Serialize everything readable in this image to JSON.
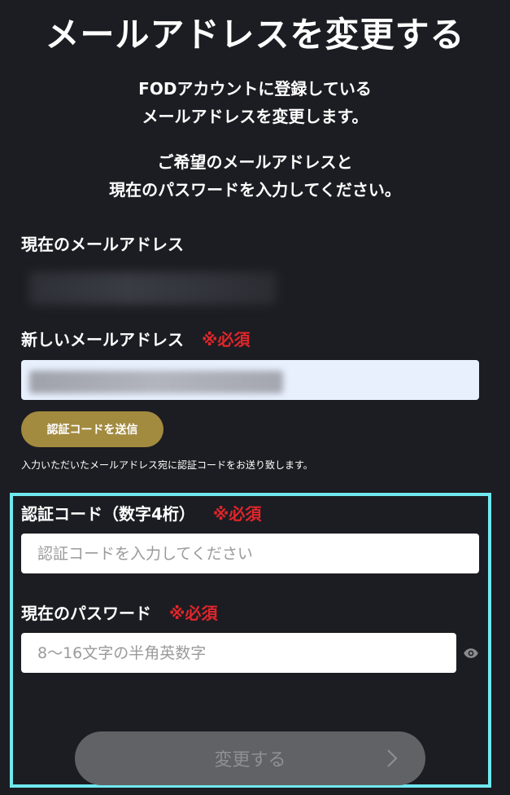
{
  "header": {
    "title": "メールアドレスを変更する"
  },
  "description": {
    "line1": "FODアカウントに登録している",
    "line2": "メールアドレスを変更します。",
    "line3": "ご希望のメールアドレスと",
    "line4": "現在のパスワードを入力してください。"
  },
  "form": {
    "current_email_label": "現在のメールアドレス",
    "new_email_label": "新しいメールアドレス",
    "required_mark": "※必須",
    "send_code_label": "認証コードを送信",
    "send_code_note": "入力いただいたメールアドレス宛に認証コードをお送り致します。",
    "code_label": "認証コード（数字4桁）",
    "code_placeholder": "認証コードを入力してください",
    "password_label": "現在のパスワード",
    "password_placeholder": "8〜16文字の半角英数字",
    "submit_label": "変更する"
  },
  "colors": {
    "background": "#1c1d22",
    "required": "#e0262b",
    "send_button": "#a28a3f",
    "highlight_border": "#6fe8ee",
    "submit_disabled": "#616265"
  },
  "icons": {
    "password_toggle": "eye-icon",
    "submit_arrow": "chevron-right-icon"
  }
}
